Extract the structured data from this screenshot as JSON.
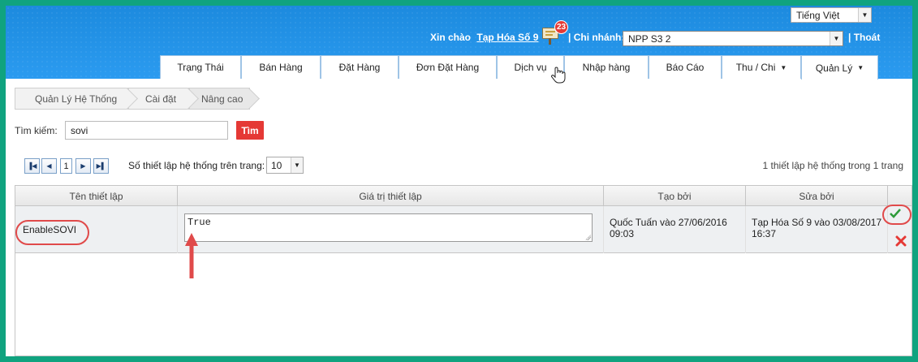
{
  "header": {
    "language": "Tiếng Việt",
    "greeting_prefix": "Xin chào",
    "user_name": "Tạp Hóa Số 9",
    "notification_count": "23",
    "branch_label": "| Chi nhánh:",
    "branch_value": "NPP S3 2",
    "logout": "| Thoát"
  },
  "tabs": [
    {
      "label": "Trạng Thái"
    },
    {
      "label": "Bán Hàng"
    },
    {
      "label": "Đặt Hàng"
    },
    {
      "label": "Đơn Đặt Hàng"
    },
    {
      "label": "Dịch vụ"
    },
    {
      "label": "Nhập hàng"
    },
    {
      "label": "Báo Cáo"
    },
    {
      "label": "Thu / Chi"
    },
    {
      "label": "Quản Lý"
    }
  ],
  "breadcrumb": [
    "Quản Lý Hệ Thống",
    "Cài đặt",
    "Nâng cao"
  ],
  "search": {
    "label": "Tìm kiếm:",
    "value": "sovi",
    "button": "Tìm"
  },
  "pager": {
    "page": "1",
    "per_page_label": "Số thiết lập hệ thống trên trang:",
    "per_page_value": "10",
    "summary": "1 thiết lập hệ thống trong 1 trang"
  },
  "table": {
    "columns": [
      "Tên thiết lập",
      "Giá trị thiết lập",
      "Tạo bởi",
      "Sửa bởi"
    ],
    "rows": [
      {
        "name": "EnableSOVI",
        "value": "True",
        "created_by": "Quốc Tuấn vào 27/06/2016 09:03",
        "modified_by": "Tạp Hóa Số 9 vào 03/08/2017 16:37"
      }
    ]
  },
  "colors": {
    "frame": "#10a37f",
    "header": "#2b9bf0",
    "search_button": "#e53935",
    "annotation": "#e04a4a",
    "confirm": "#2e9b3a"
  },
  "icons": [
    "notification-board-icon",
    "hand-cursor-icon",
    "first-page-icon",
    "prev-page-icon",
    "next-page-icon",
    "last-page-icon",
    "checkmark-icon",
    "delete-x-icon"
  ]
}
